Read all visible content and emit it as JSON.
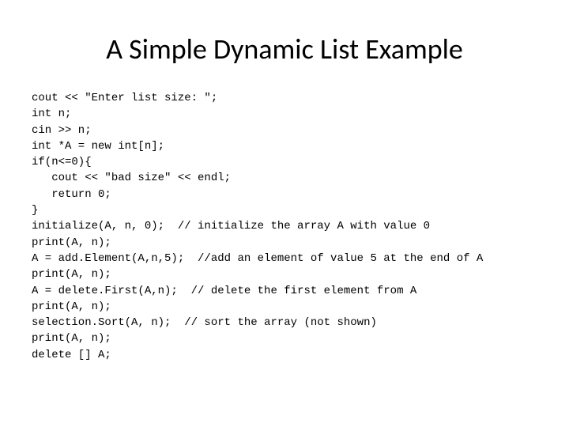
{
  "title": "A Simple Dynamic List Example",
  "code": {
    "l1": "cout << \"Enter list size: \";",
    "l2": "int n;",
    "l3": "cin >> n;",
    "l4": "int *A = new int[n];",
    "l5": "if(n<=0){",
    "l6": "   cout << \"bad size\" << endl;",
    "l7": "   return 0;",
    "l8": "}",
    "l9": "initialize(A, n, 0);  // initialize the array A with value 0",
    "l10": "print(A, n);",
    "l11": "A = add.Element(A,n,5);  //add an element of value 5 at the end of A",
    "l12": "print(A, n);",
    "l13": "A = delete.First(A,n);  // delete the first element from A",
    "l14": "print(A, n);",
    "l15": "selection.Sort(A, n);  // sort the array (not shown)",
    "l16": "print(A, n);",
    "l17": "delete [] A;"
  }
}
